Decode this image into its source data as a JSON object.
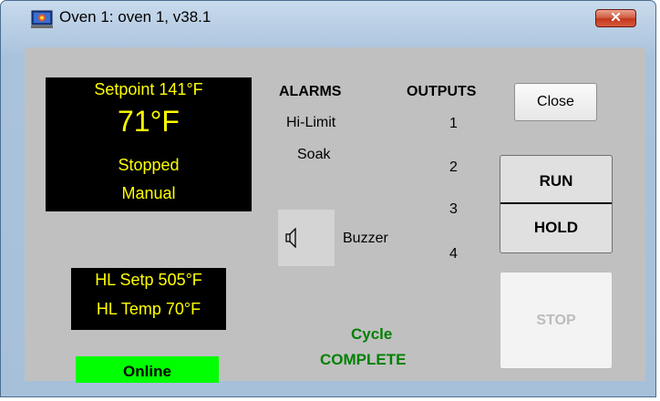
{
  "window": {
    "title": "Oven 1: oven 1, v38.1",
    "close_glyph": "✕",
    "icon": "oven-app-icon"
  },
  "display": {
    "setpoint": "Setpoint 141°F",
    "temperature": "71°F",
    "state": "Stopped",
    "mode": "Manual",
    "text_color": "#ffff00",
    "background": "#000000"
  },
  "high_limit": {
    "setpoint": "HL Setp 505°F",
    "temperature": "HL Temp 70°F"
  },
  "status": {
    "label": "Online",
    "color": "#00ff00"
  },
  "alarms": {
    "header": "ALARMS",
    "items": [
      "Hi-Limit",
      "Soak"
    ]
  },
  "outputs": {
    "header": "OUTPUTS",
    "items": [
      "1",
      "2",
      "3",
      "4"
    ]
  },
  "buzzer": {
    "label": "Buzzer",
    "icon": "speaker-icon"
  },
  "buttons": {
    "close": "Close",
    "run": "RUN",
    "hold": "HOLD",
    "stop": "STOP",
    "stop_enabled": false
  },
  "cycle": {
    "line1": "Cycle",
    "line2": "COMPLETE",
    "color": "#008000"
  }
}
